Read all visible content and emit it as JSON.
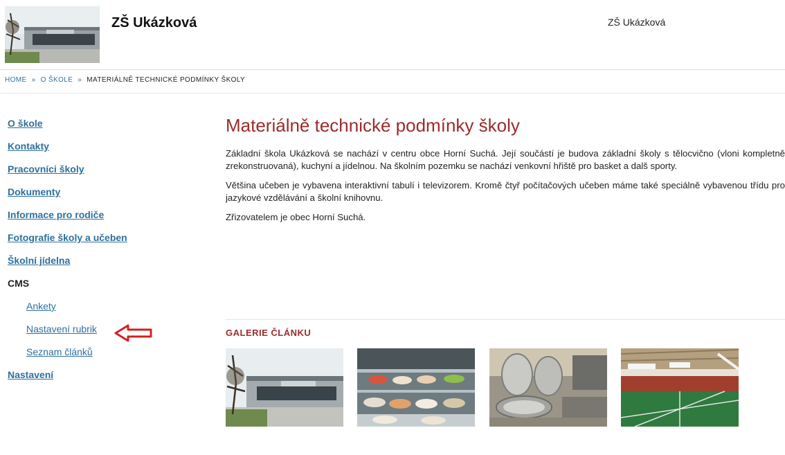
{
  "header": {
    "site_title": "ZŠ Ukázková",
    "right_text": "ZŠ Ukázková"
  },
  "breadcrumb": {
    "items": [
      "Home",
      "O škole",
      "Materiálně technické podmínky školy"
    ],
    "separator": "»"
  },
  "sidebar": {
    "items": [
      {
        "label": "O škole"
      },
      {
        "label": "Kontakty"
      },
      {
        "label": "Pracovníci školy"
      },
      {
        "label": "Dokumenty"
      },
      {
        "label": "Informace pro rodiče"
      },
      {
        "label": "Fotografie školy a učeben"
      },
      {
        "label": "Školní jídelna"
      }
    ],
    "cms_label": "CMS",
    "cms_items": [
      {
        "label": "Ankety"
      },
      {
        "label": "Nastavení rubrik"
      },
      {
        "label": "Seznam článků"
      }
    ],
    "settings_label": "Nastavení"
  },
  "main": {
    "title": "Materiálně technické podmínky školy",
    "paragraphs": [
      "Základní škola Ukázková se nachází v centru obce Horní Suchá. Její součástí je budova základní školy s tělocvično (vloni kompletně zrekonstruovaná), kuchyní a jídelnou. Na školním pozemku se nachází venkovní hřiště pro basket a dalš sporty.",
      "Většina učeben je vybavena interaktivní tabulí i televizorem.  Kromě čtyř počítačových učeben máme také speciálně vybavenou třídu pro jazykové vzdělávání a školní knihovnu.",
      "Zřizovatelem je obec Horní Suchá."
    ],
    "gallery_title": "GALERIE ČLÁNKU"
  },
  "colors": {
    "link": "#2e6f9c",
    "title": "#9b2b2b",
    "arrow": "#d42020"
  },
  "icons": [
    "red-arrow-annotation"
  ]
}
